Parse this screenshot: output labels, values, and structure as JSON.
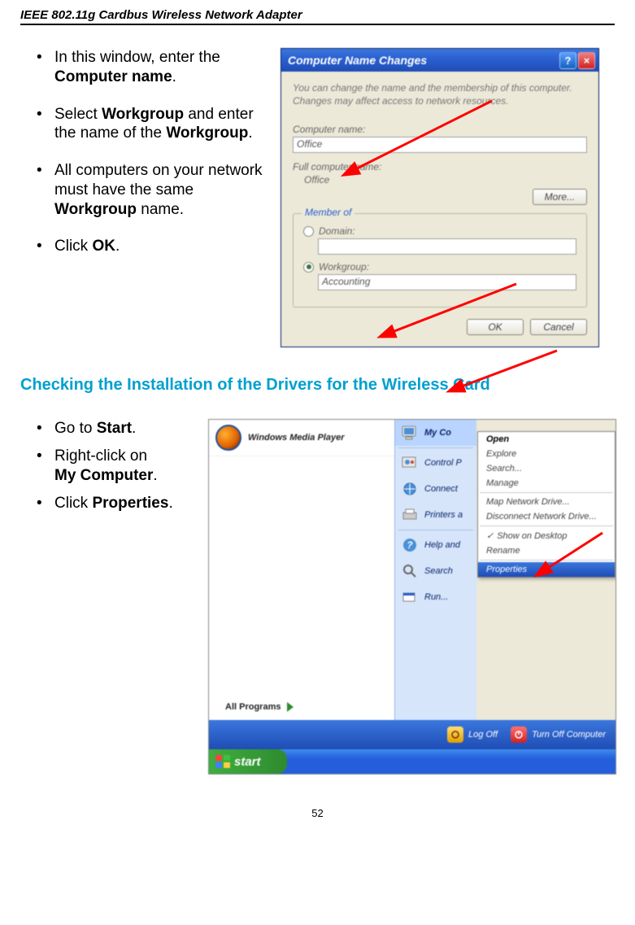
{
  "header": "IEEE 802.11g Cardbus Wireless Network Adapter",
  "page_number": "52",
  "section1": {
    "bullets": {
      "b1a": "In this window, enter the ",
      "b1b": "Computer name",
      "b1c": ".",
      "b2a": "Select ",
      "b2b": "Workgroup",
      "b2c": " and enter the name of the ",
      "b2d": "Workgroup",
      "b2e": ".",
      "b3a": "All computers on your network must have the same ",
      "b3b": "Workgroup",
      "b3c": " name.",
      "b4a": " Click ",
      "b4b": "OK",
      "b4c": "."
    }
  },
  "dialog1": {
    "title": "Computer Name Changes",
    "desc": "You can change the name and the membership of this computer. Changes may affect access to network resources.",
    "computer_name_label": "Computer name:",
    "computer_name_value": "Office",
    "full_name_label": "Full computer name:",
    "full_name_value": "Office",
    "more_btn": "More...",
    "member_of": "Member of",
    "domain_label": "Domain:",
    "domain_value": "",
    "workgroup_label": "Workgroup:",
    "workgroup_value": "Accounting",
    "ok": "OK",
    "cancel": "Cancel"
  },
  "section_title": "Checking the Installation of the Drivers for the Wireless Card",
  "section2": {
    "bullets": {
      "b1a": "Go to ",
      "b1b": "Start",
      "b1c": ".",
      "b2a": "Right-click on",
      "b2b": "My Computer",
      "b2c": ".",
      "b3a": "Click ",
      "b3b": "Properties",
      "b3c": "."
    }
  },
  "startmenu": {
    "wmp": "Windows Media Player",
    "all_programs": "All Programs",
    "right_items": {
      "mycomp": "My Co",
      "control": "Control P",
      "connect": "Connect",
      "printers": "Printers a",
      "help": "Help and",
      "search": "Search",
      "run": "Run..."
    },
    "context": {
      "open": "Open",
      "explore": "Explore",
      "search": "Search...",
      "manage": "Manage",
      "map": "Map Network Drive...",
      "disconnect": "Disconnect Network Drive...",
      "show_desktop": "Show on Desktop",
      "rename": "Rename",
      "properties": "Properties"
    },
    "logoff": "Log Off",
    "turnoff": "Turn Off Computer",
    "start": "start"
  }
}
